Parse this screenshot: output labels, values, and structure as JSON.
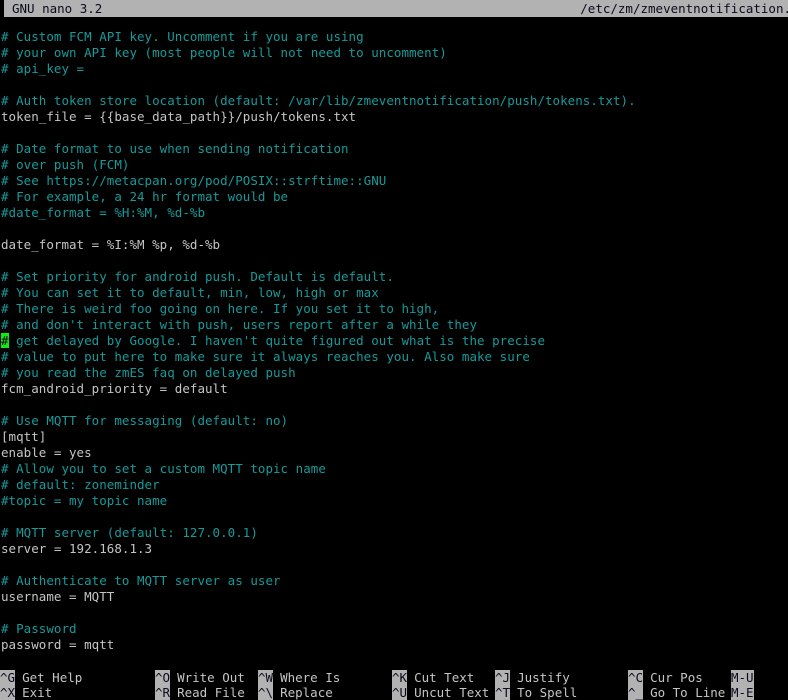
{
  "titlebar": {
    "app_version": "GNU nano 3.2",
    "file_path": "/etc/zm/zmeventnotification."
  },
  "editor": {
    "lines": [
      {
        "text": "# Custom FCM API key. Uncomment if you are using",
        "type": "comment"
      },
      {
        "text": "# your own API key (most people will not need to uncomment)",
        "type": "comment"
      },
      {
        "text": "# api_key =",
        "type": "comment"
      },
      {
        "text": "",
        "type": "blank"
      },
      {
        "text": "# Auth token store location (default: /var/lib/zmeventnotification/push/tokens.txt).",
        "type": "comment"
      },
      {
        "text": "token_file = {{base_data_path}}/push/tokens.txt",
        "type": "value"
      },
      {
        "text": "",
        "type": "blank"
      },
      {
        "text": "# Date format to use when sending notification",
        "type": "comment"
      },
      {
        "text": "# over push (FCM)",
        "type": "comment"
      },
      {
        "text": "# See https://metacpan.org/pod/POSIX::strftime::GNU",
        "type": "comment"
      },
      {
        "text": "# For example, a 24 hr format would be",
        "type": "comment"
      },
      {
        "text": "#date_format = %H:%M, %d-%b",
        "type": "comment"
      },
      {
        "text": "",
        "type": "blank"
      },
      {
        "text": "date_format = %I:%M %p, %d-%b",
        "type": "value"
      },
      {
        "text": "",
        "type": "blank"
      },
      {
        "text": "# Set priority for android push. Default is default.",
        "type": "comment"
      },
      {
        "text": "# You can set it to default, min, low, high or max",
        "type": "comment"
      },
      {
        "text": "# There is weird foo going on here. If you set it to high,",
        "type": "comment"
      },
      {
        "text": "# and don't interact with push, users report after a while they",
        "type": "comment"
      },
      {
        "text": "# get delayed by Google. I haven't quite figured out what is the precise",
        "type": "comment",
        "cursor_col": 0
      },
      {
        "text": "# value to put here to make sure it always reaches you. Also make sure",
        "type": "comment"
      },
      {
        "text": "# you read the zmES faq on delayed push",
        "type": "comment"
      },
      {
        "text": "fcm_android_priority = default",
        "type": "value"
      },
      {
        "text": "",
        "type": "blank"
      },
      {
        "text": "# Use MQTT for messaging (default: no)",
        "type": "comment"
      },
      {
        "text": "[mqtt]",
        "type": "value"
      },
      {
        "text": "enable = yes",
        "type": "value"
      },
      {
        "text": "# Allow you to set a custom MQTT topic name",
        "type": "comment"
      },
      {
        "text": "# default: zoneminder",
        "type": "comment"
      },
      {
        "text": "#topic = my topic name",
        "type": "comment"
      },
      {
        "text": "",
        "type": "blank"
      },
      {
        "text": "# MQTT server (default: 127.0.0.1)",
        "type": "comment"
      },
      {
        "text": "server = 192.168.1.3",
        "type": "value"
      },
      {
        "text": "",
        "type": "blank"
      },
      {
        "text": "# Authenticate to MQTT server as user",
        "type": "comment"
      },
      {
        "text": "username = MQTT",
        "type": "value"
      },
      {
        "text": "",
        "type": "blank"
      },
      {
        "text": "# Password",
        "type": "comment"
      },
      {
        "text": "password = mqtt",
        "type": "value"
      }
    ]
  },
  "shortcutbar": {
    "row1": [
      {
        "key": "^G",
        "label": "Get Help"
      },
      {
        "key": "^O",
        "label": "Write Out"
      },
      {
        "key": "^W",
        "label": "Where Is"
      },
      {
        "key": "^K",
        "label": "Cut Text"
      },
      {
        "key": "^J",
        "label": "Justify"
      },
      {
        "key": "^C",
        "label": "Cur Pos"
      },
      {
        "key": "M-U",
        "label": ""
      }
    ],
    "row2": [
      {
        "key": "^X",
        "label": "Exit"
      },
      {
        "key": "^R",
        "label": "Read File"
      },
      {
        "key": "^\\",
        "label": "Replace"
      },
      {
        "key": "^U",
        "label": "Uncut Text"
      },
      {
        "key": "^T",
        "label": "To Spell"
      },
      {
        "key": "^_",
        "label": "Go To Line"
      },
      {
        "key": "M-E",
        "label": ""
      }
    ]
  },
  "colors": {
    "background": "#000000",
    "comment_text": "#179a9a",
    "normal_text": "#c5c5c5",
    "bar_background": "#b2b2b2",
    "bar_text": "#0b0b1e",
    "cursor": "#12e812"
  }
}
